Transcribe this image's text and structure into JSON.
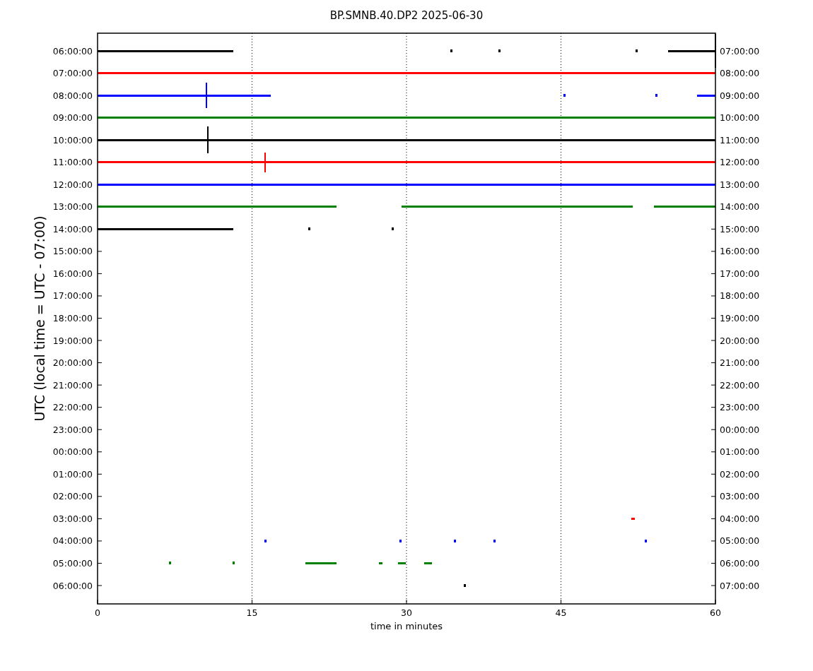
{
  "title": "BP.SMNB.40.DP2 2025-06-30",
  "ylabel": "UTC (local time = UTC - 07:00)",
  "xlabel": "time in minutes",
  "xticks": [
    "0",
    "15",
    "30",
    "45",
    "60"
  ],
  "rows": [
    {
      "left": "06:00:00",
      "right": "07:00:00",
      "color": "#000000"
    },
    {
      "left": "07:00:00",
      "right": "08:00:00",
      "color": "#ff0000"
    },
    {
      "left": "08:00:00",
      "right": "09:00:00",
      "color": "#0000ff"
    },
    {
      "left": "09:00:00",
      "right": "10:00:00",
      "color": "#008000"
    },
    {
      "left": "10:00:00",
      "right": "11:00:00",
      "color": "#000000"
    },
    {
      "left": "11:00:00",
      "right": "12:00:00",
      "color": "#ff0000"
    },
    {
      "left": "12:00:00",
      "right": "13:00:00",
      "color": "#0000ff"
    },
    {
      "left": "13:00:00",
      "right": "14:00:00",
      "color": "#008000"
    },
    {
      "left": "14:00:00",
      "right": "15:00:00",
      "color": "#000000"
    },
    {
      "left": "15:00:00",
      "right": "16:00:00"
    },
    {
      "left": "16:00:00",
      "right": "17:00:00"
    },
    {
      "left": "17:00:00",
      "right": "18:00:00"
    },
    {
      "left": "18:00:00",
      "right": "19:00:00"
    },
    {
      "left": "19:00:00",
      "right": "20:00:00"
    },
    {
      "left": "20:00:00",
      "right": "21:00:00"
    },
    {
      "left": "21:00:00",
      "right": "22:00:00"
    },
    {
      "left": "22:00:00",
      "right": "23:00:00"
    },
    {
      "left": "23:00:00",
      "right": "00:00:00"
    },
    {
      "left": "00:00:00",
      "right": "01:00:00"
    },
    {
      "left": "01:00:00",
      "right": "02:00:00"
    },
    {
      "left": "02:00:00",
      "right": "03:00:00"
    },
    {
      "left": "03:00:00",
      "right": "04:00:00",
      "color": "#ff0000"
    },
    {
      "left": "04:00:00",
      "right": "05:00:00",
      "color": "#0000ff"
    },
    {
      "left": "05:00:00",
      "right": "06:00:00",
      "color": "#008000"
    },
    {
      "left": "06:00:00",
      "right": "07:00:00",
      "color": "#000000"
    }
  ]
}
